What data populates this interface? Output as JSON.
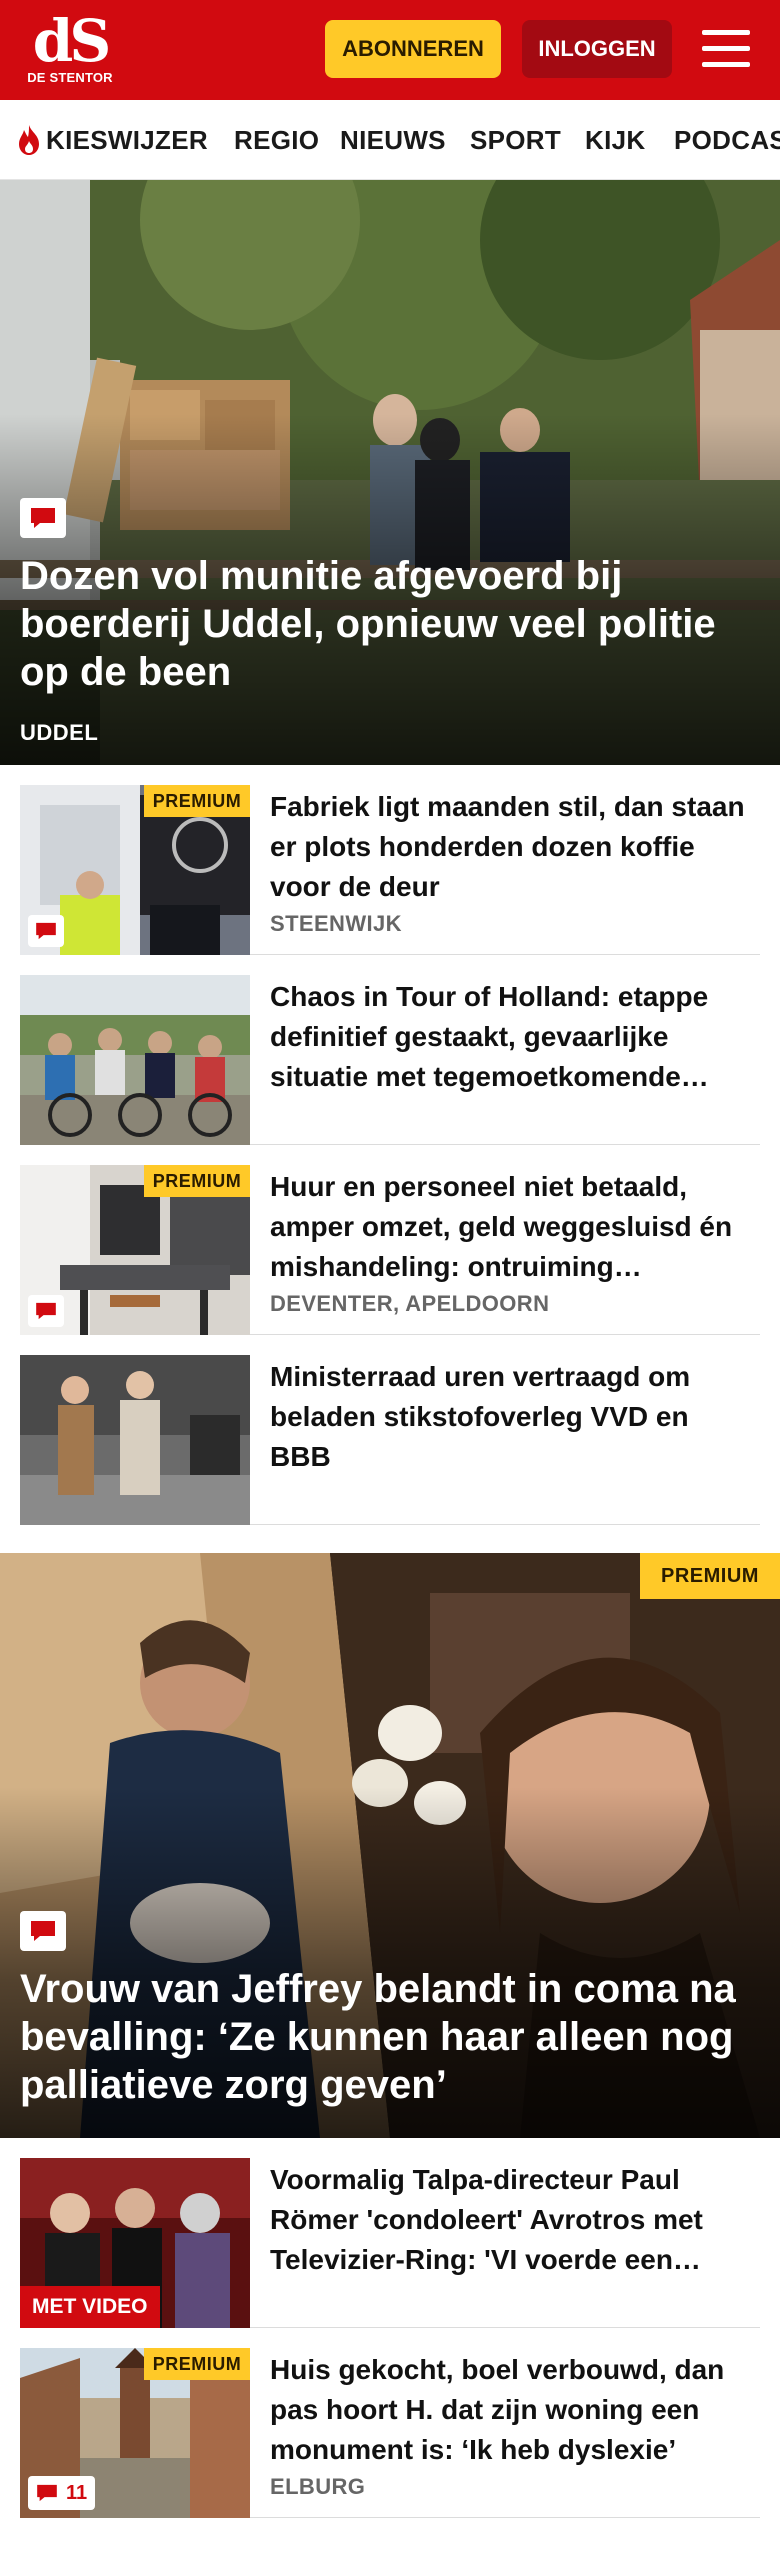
{
  "brand": {
    "logo_mark": "dS",
    "logo_text": "DE STENTOR",
    "color_primary": "#d10a10",
    "color_accent": "#ffc928"
  },
  "header": {
    "subscribe_label": "ABONNEREN",
    "login_label": "INLOGGEN",
    "menu_icon": "hamburger-menu-icon"
  },
  "nav": {
    "items": [
      {
        "label": "KIESWIJZER",
        "icon": "flame-icon"
      },
      {
        "label": "REGIO"
      },
      {
        "label": "NIEUWS"
      },
      {
        "label": "SPORT"
      },
      {
        "label": "KIJK"
      },
      {
        "label": "PODCAST"
      }
    ]
  },
  "hero1": {
    "title": "Dozen vol munitie afgevoerd bij boerderij Uddel, opnieuw veel politie op de been",
    "label": "UDDEL",
    "has_comments": true
  },
  "articles1": [
    {
      "title": "Fabriek ligt maanden stil, dan staan er plots honderden dozen koffie voor de deur",
      "label": "STEENWIJK",
      "premium": "PREMIUM",
      "has_comments": true
    },
    {
      "title": "Chaos in Tour of Holland: etappe definitief gestaakt, gevaarlijke situatie met tegemoetkomende…",
      "label": "",
      "premium": "",
      "has_comments": false
    },
    {
      "title": "Huur en personeel niet betaald, amper omzet, geld weggesluisd én mishandeling: ontruiming…",
      "label": "DEVENTER, APELDOORN",
      "premium": "PREMIUM",
      "has_comments": true
    },
    {
      "title": "Ministerraad uren vertraagd om beladen stikstofoverleg VVD en BBB",
      "label": "",
      "premium": "",
      "has_comments": false
    }
  ],
  "hero2": {
    "title": "Vrouw van Jeffrey belandt in coma na bevalling: ‘Ze kunnen haar alleen nog palliatieve zorg geven’",
    "premium": "PREMIUM",
    "has_comments": true
  },
  "articles2": [
    {
      "title": "Voormalig Talpa-directeur Paul Römer 'condoleert' Avrotros met Televizier-Ring: 'VI voerde een…",
      "label": "",
      "video_label": "MET VIDEO"
    },
    {
      "title": "Huis gekocht, boel verbouwd, dan pas hoort H. dat zijn woning een monument is: ‘Ik heb dyslexie’",
      "label": "ELBURG",
      "premium": "PREMIUM",
      "comment_count": "11"
    }
  ]
}
